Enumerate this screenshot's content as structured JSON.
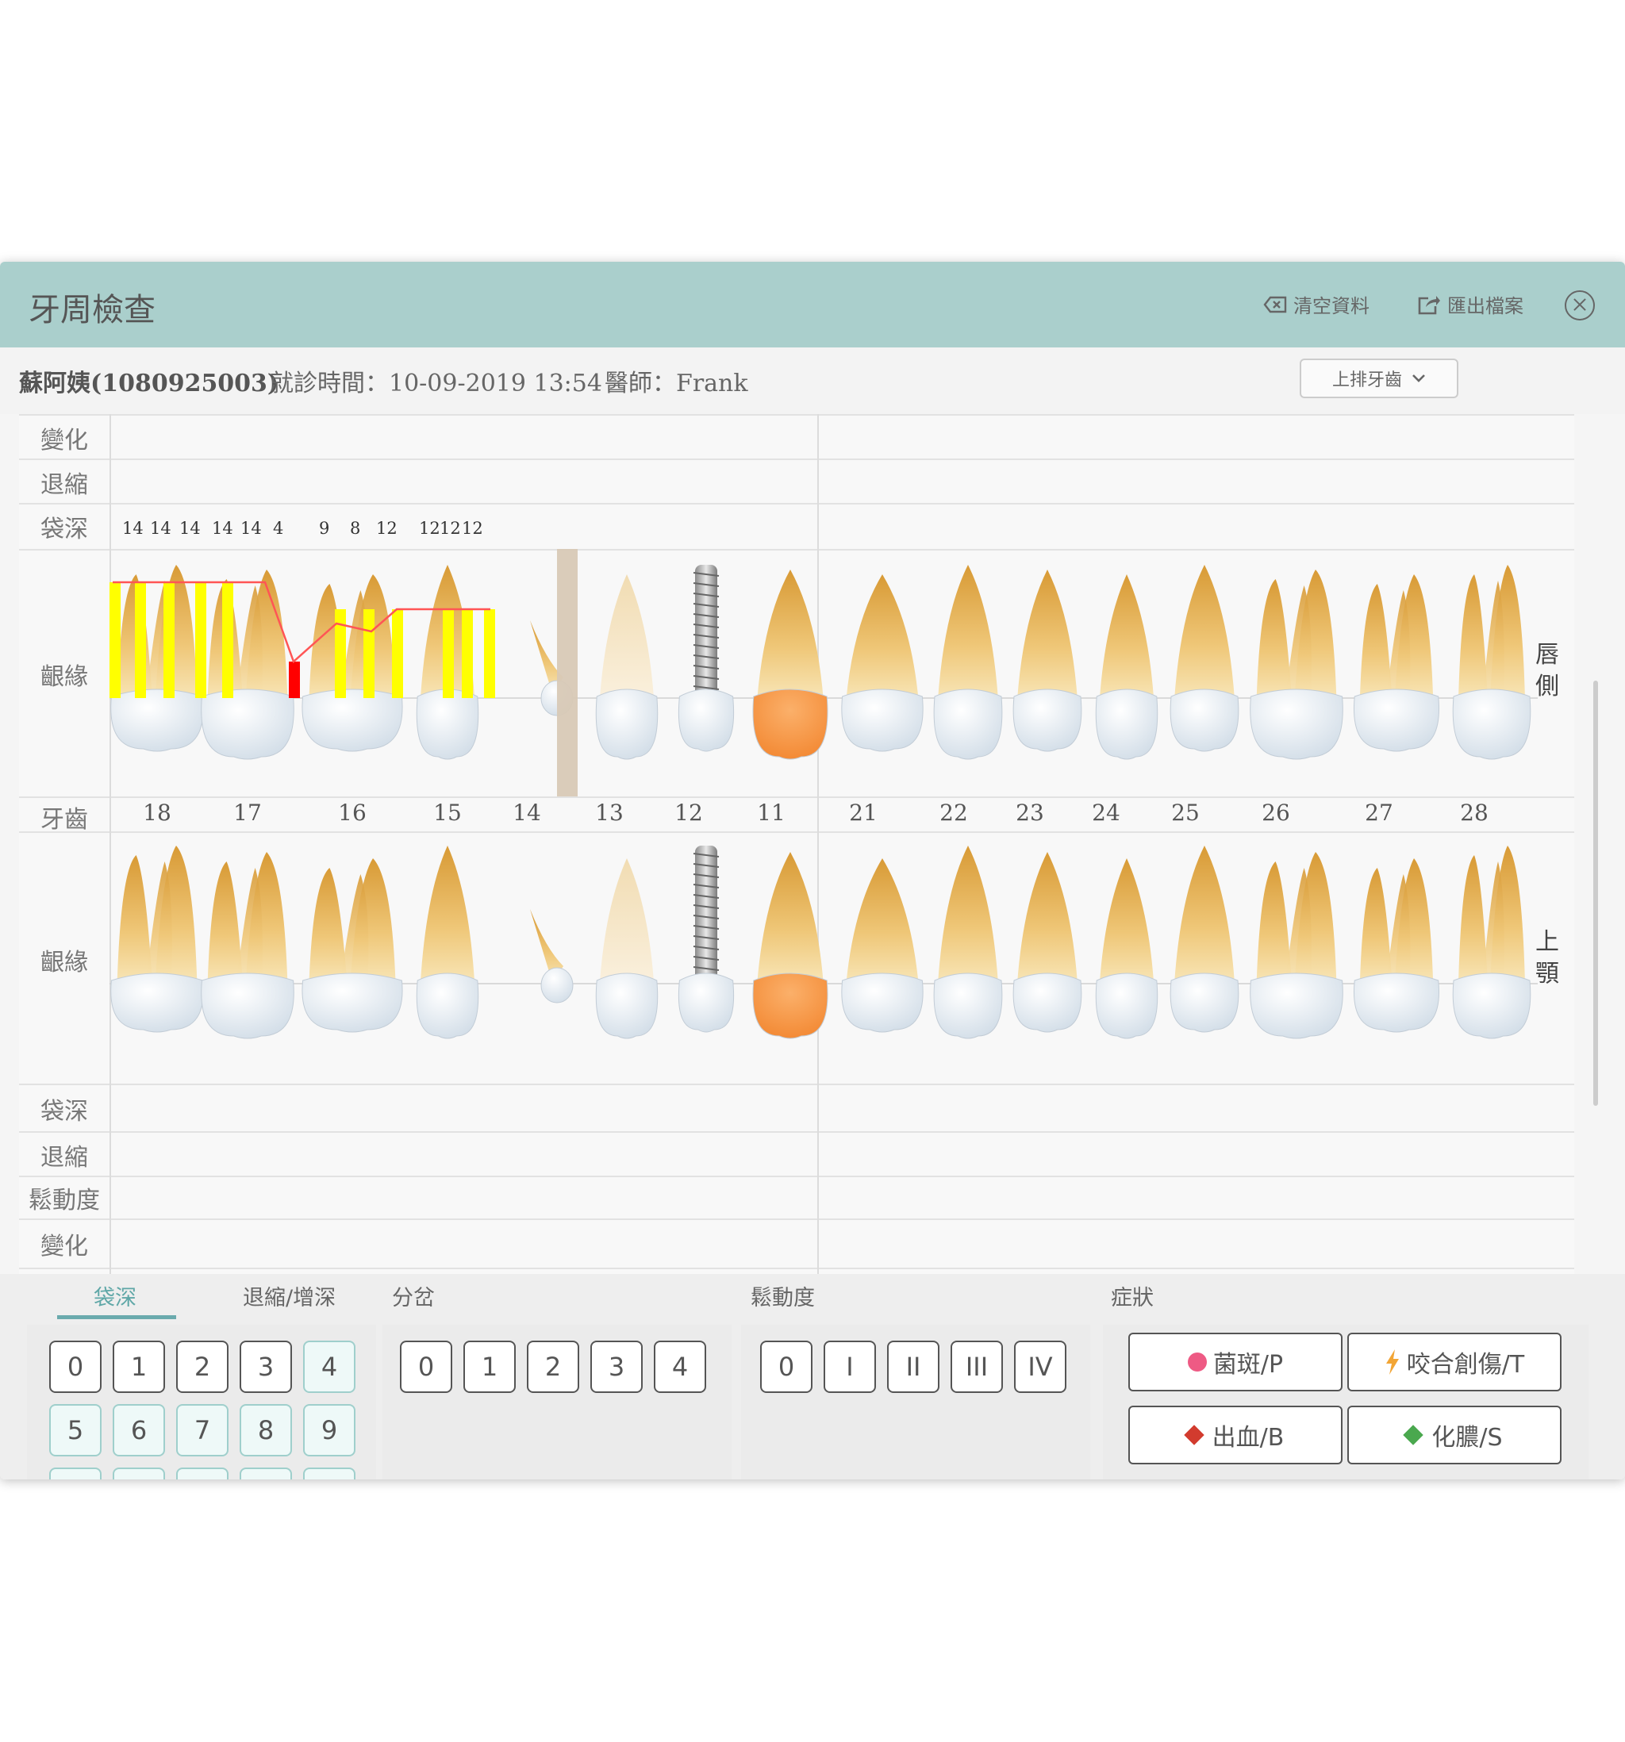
{
  "window": {
    "title": "牙周檢查",
    "clear_label": "清空資料",
    "export_label": "匯出檔案",
    "close_icon": "close-icon"
  },
  "info": {
    "patient": "蘇阿姨(1080925003)",
    "visit": "就診時間：10-09-2019 13:54",
    "doctor": "醫師：Frank",
    "arch_select": "上排牙齒"
  },
  "labels": {
    "change_top": "變化",
    "recession_top": "退縮",
    "pocket_top": "袋深",
    "gingiva_top": "齦緣",
    "tooth": "牙齒",
    "gingiva_bottom": "齦緣",
    "pocket_bottom": "袋深",
    "recession_bottom": "退縮",
    "mobility": "鬆動度",
    "change_bottom": "變化"
  },
  "side_labels": {
    "labial": "唇側",
    "jaw": "上顎"
  },
  "pocket_depths": [
    "14",
    "14",
    "14",
    "14",
    "14",
    "4",
    "9",
    "8",
    "12",
    "12",
    "12",
    "12"
  ],
  "tooth_numbers": [
    "18",
    "17",
    "16",
    "15",
    "14",
    "13",
    "12",
    "11",
    "21",
    "22",
    "23",
    "24",
    "25",
    "26",
    "27",
    "28"
  ],
  "colors": {
    "accent": "#aacfcc",
    "pocket_bar": "#ffff00",
    "bleeding_bar": "#ff0000",
    "gingival_line": "#ff5555",
    "highlight_crown": "#f5923e"
  },
  "bottom": {
    "tabs": [
      "袋深",
      "退縮/增深"
    ],
    "furcation_title": "分岔",
    "mobility_title": "鬆動度",
    "symptom_title": "症狀",
    "pocket_keys": [
      "0",
      "1",
      "2",
      "3",
      "4",
      "5",
      "6",
      "7",
      "8",
      "9"
    ],
    "furcation_keys": [
      "0",
      "1",
      "2",
      "3",
      "4"
    ],
    "mobility_keys": [
      "0",
      "I",
      "II",
      "III",
      "IV"
    ],
    "symptoms": [
      "菌斑/P",
      "咬合創傷/T",
      "出血/B",
      "化膿/S"
    ]
  }
}
